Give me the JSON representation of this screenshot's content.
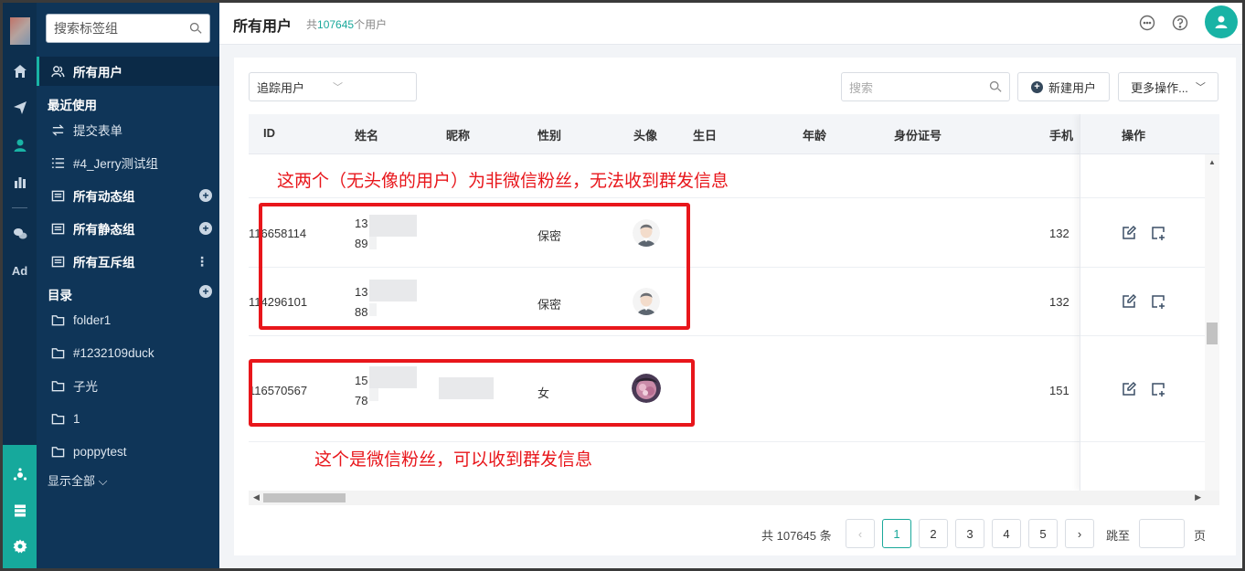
{
  "sidebar": {
    "search_placeholder": "搜索标签组",
    "all_users": "所有用户",
    "recent_heading": "最近使用",
    "recent": [
      "提交表单",
      "#4_Jerry测试组"
    ],
    "groups": [
      "所有动态组",
      "所有静态组",
      "所有互斥组"
    ],
    "catalog_heading": "目录",
    "folders": [
      "folder1",
      "#1232109duck",
      "子光",
      "1",
      "poppytest"
    ],
    "show_all": "显示全部 ⌵"
  },
  "rail": {
    "icons": [
      "home-icon",
      "send-icon",
      "user-icon",
      "bar-chart-icon",
      "wechat-icon"
    ],
    "ad_label": "Ad",
    "bottom_icons": [
      "hub-icon",
      "server-icon",
      "gear-icon"
    ]
  },
  "header": {
    "title": "所有用户",
    "count_prefix": "共",
    "count_value": "107645",
    "count_suffix": "个用户"
  },
  "toolbar": {
    "filter_value": "追踪用户",
    "search_placeholder": "搜索",
    "new_user": "新建用户",
    "more_actions": "更多操作..."
  },
  "table": {
    "columns": [
      "ID",
      "姓名",
      "昵称",
      "性别",
      "头像",
      "生日",
      "年龄",
      "身份证号",
      "手机",
      "操作"
    ],
    "rows": [
      {
        "id": "116658114",
        "name_top": "13",
        "name_bottom": "89",
        "gender": "保密",
        "phone": "132"
      },
      {
        "id": "114296101",
        "name_top": "13",
        "name_bottom": "88",
        "gender": "保密",
        "phone": "132"
      },
      {
        "id": "116570567",
        "name_top": "15",
        "name_bottom": "78",
        "gender": "女",
        "phone": "151"
      }
    ]
  },
  "annotations": {
    "top": "这两个（无头像的用户）为非微信粉丝，无法收到群发信息",
    "bottom": "这个是微信粉丝，可以收到群发信息"
  },
  "pagination": {
    "total": "共 107645 条",
    "pages": [
      "1",
      "2",
      "3",
      "4",
      "5"
    ],
    "current": "1",
    "jump_label": "跳至",
    "jump_unit": "页"
  },
  "colors": {
    "accent": "#19b3a5",
    "sidebar": "#0f3558",
    "annotation": "#e8161b"
  }
}
